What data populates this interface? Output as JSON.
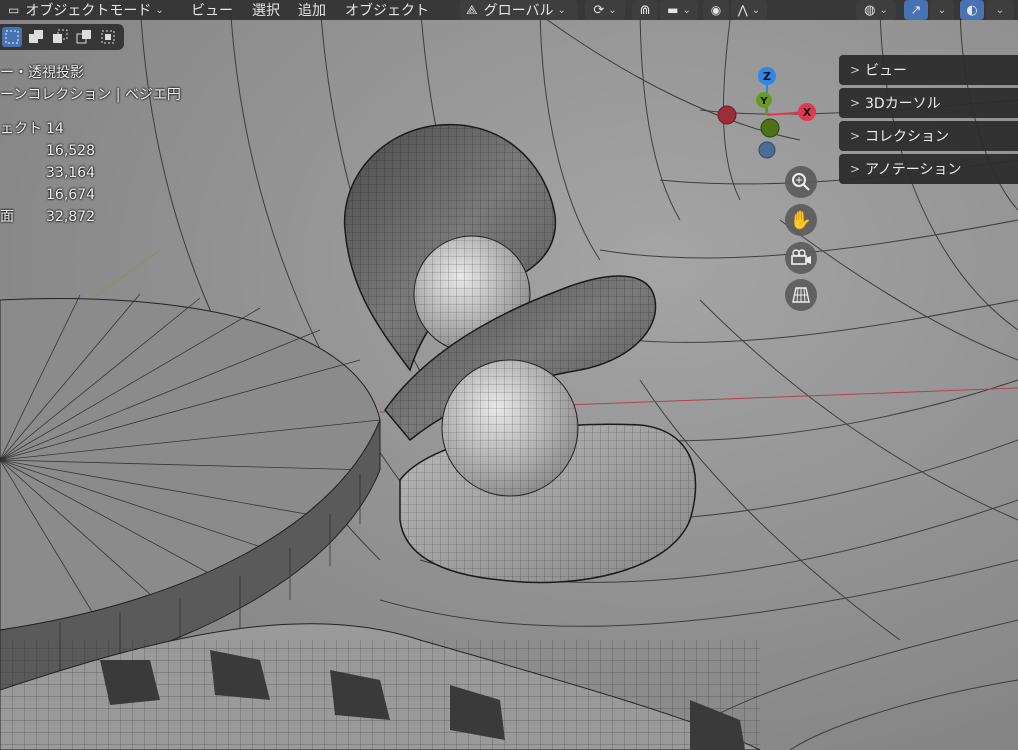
{
  "header": {
    "mode": "オブジェクトモード",
    "menu_view": "ビュー",
    "menu_select": "選択",
    "menu_add": "追加",
    "menu_object": "オブジェクト",
    "transform_orientation": "グローバル"
  },
  "overlay": {
    "view_name": "ー・透視投影",
    "collection": "ーンコレクション | ベジエ円",
    "stats": [
      {
        "label": "ェクト",
        "value": "14"
      },
      {
        "label": "",
        "value": "16,528"
      },
      {
        "label": "",
        "value": "33,164"
      },
      {
        "label": "",
        "value": "16,674"
      },
      {
        "label": "面",
        "value": "32,872"
      }
    ]
  },
  "npanel": {
    "items": [
      "ビュー",
      "3Dカーソル",
      "コレクション",
      "アノテーション"
    ]
  },
  "gizmo": {
    "z_label": "Z",
    "y_label": "Y",
    "x_label": "X",
    "colors": {
      "x": "#e2374f",
      "y": "#6a9a1f",
      "z": "#2e86e8"
    }
  },
  "nav_icons": [
    "zoom-icon",
    "hand-pan-icon",
    "camera-view-icon",
    "ortho-grid-icon"
  ],
  "colors": {
    "header_bg": "#303030",
    "accent": "#4772b3",
    "viewport": "#8e8e8e"
  }
}
